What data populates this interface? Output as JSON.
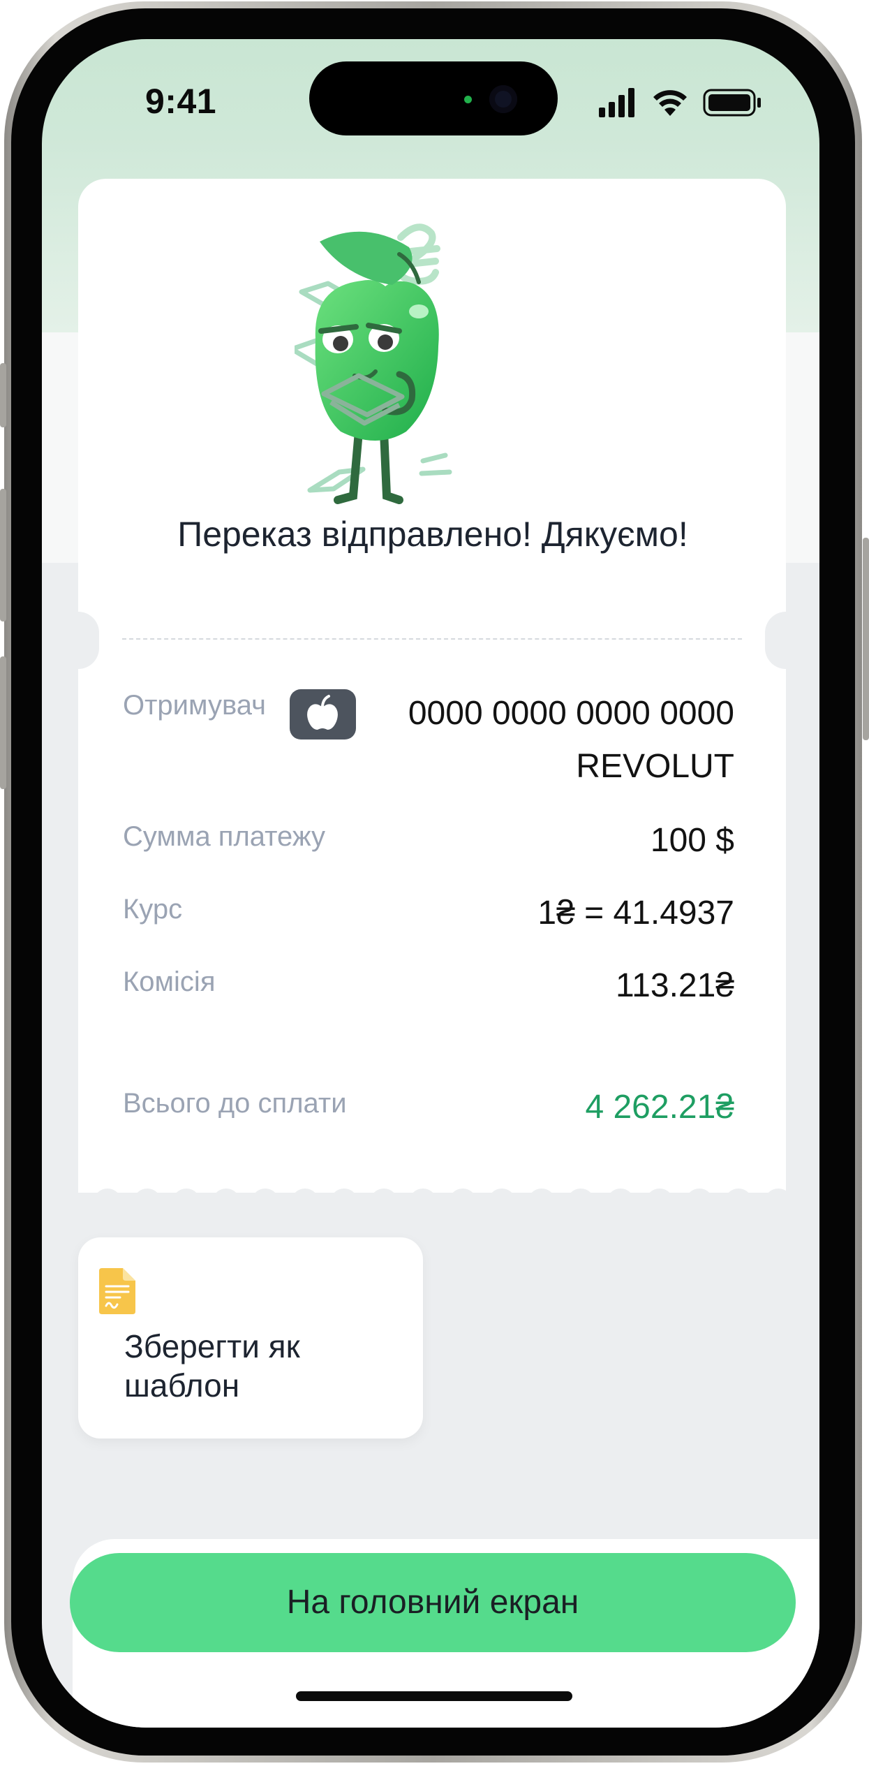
{
  "status_bar": {
    "time": "9:41"
  },
  "ticket": {
    "title": "Переказ відправлено! Дякуємо!",
    "recipient": {
      "label": "Отримувач",
      "card": "0000 0000 0000 0000",
      "bank": "REVOLUT"
    },
    "amount": {
      "label": "Сумма платежу",
      "value": "100 $"
    },
    "rate": {
      "label": "Курс",
      "value": "1₴ = 41.4937"
    },
    "fee": {
      "label": "Комісія",
      "value": "113.21₴"
    },
    "total": {
      "label": "Всього до сплати",
      "value": "4 262.21₴"
    },
    "illustration_currency": "₴"
  },
  "save_template": {
    "label": "Зберегти як шаблон",
    "icon": "document-icon"
  },
  "home_button": {
    "label": "На головний екран"
  },
  "colors": {
    "accent": "#55db8c",
    "total_green": "#1e9e62",
    "label_grey": "#9aa3b3"
  }
}
